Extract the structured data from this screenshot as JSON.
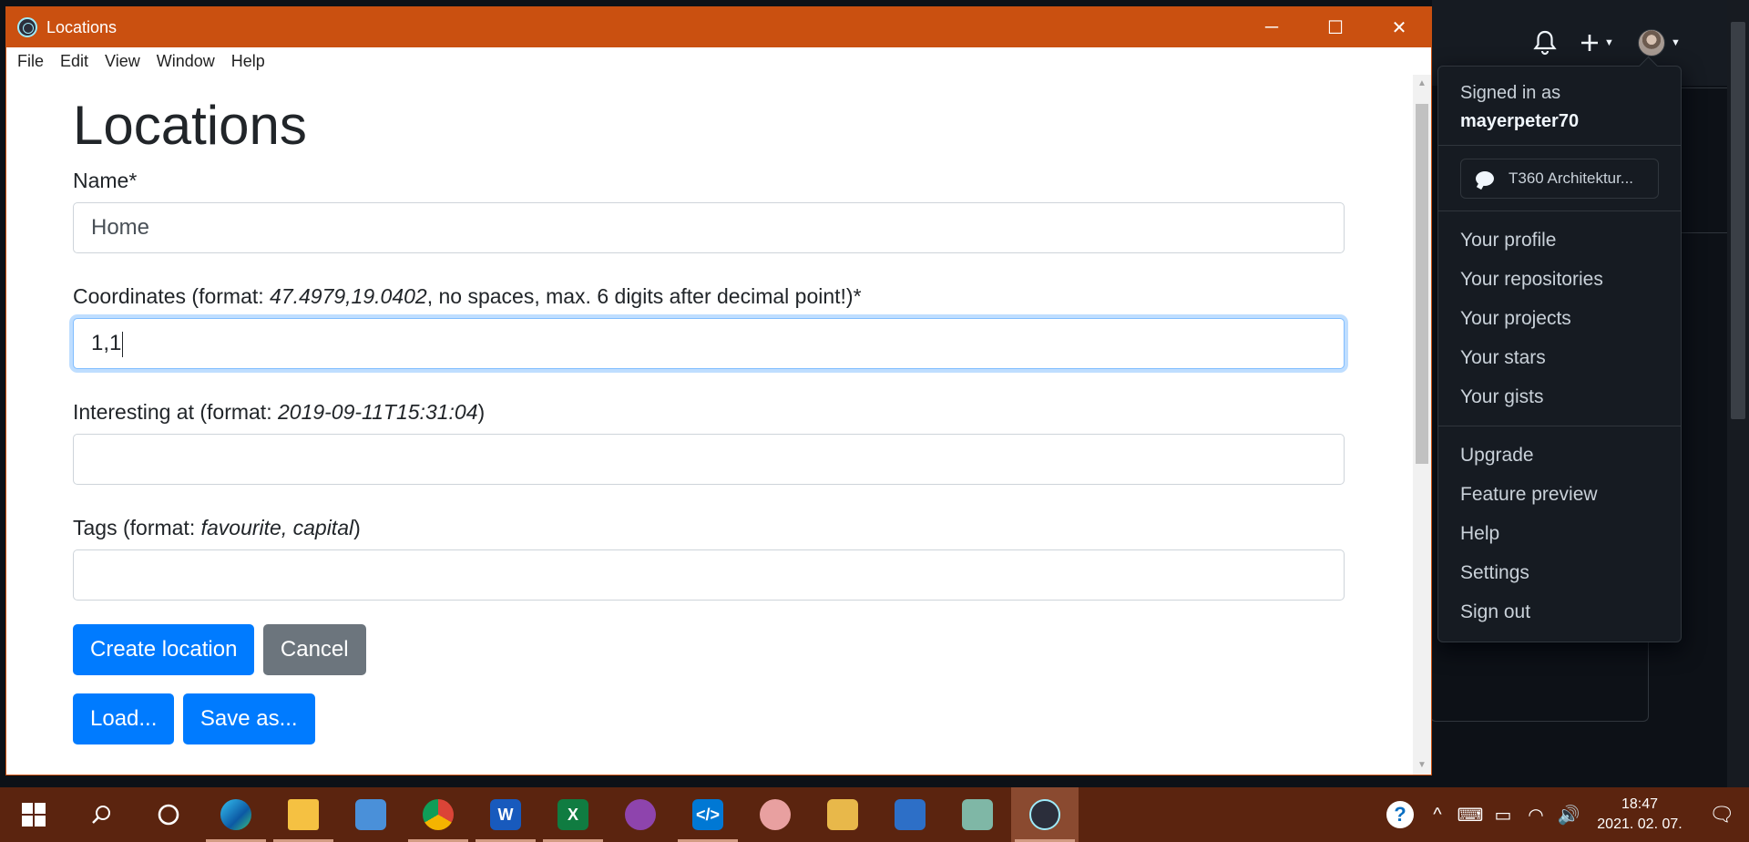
{
  "window": {
    "title": "Locations",
    "menu": [
      "File",
      "Edit",
      "View",
      "Window",
      "Help"
    ]
  },
  "form": {
    "heading": "Locations",
    "name_label": "Name*",
    "name_value": "Home",
    "coord_label_pre": "Coordinates (format: ",
    "coord_label_example": "47.4979,19.0402",
    "coord_label_post": ", no spaces, max. 6 digits after decimal point!)*",
    "coord_value": "1,1",
    "interesting_label_pre": "Interesting at (format: ",
    "interesting_label_example": "2019-09-11T15:31:04",
    "interesting_label_post": ")",
    "interesting_value": "",
    "tags_label_pre": "Tags (format: ",
    "tags_label_example": "favourite, capital",
    "tags_label_post": ")",
    "tags_value": "",
    "create_button": "Create location",
    "cancel_button": "Cancel",
    "load_button": "Load...",
    "saveas_button": "Save as..."
  },
  "github": {
    "signed_in_as": "Signed in as",
    "username": "mayerpeter70",
    "status": "T360 Architektur...",
    "menu_group1": [
      "Your profile",
      "Your repositories",
      "Your projects",
      "Your stars",
      "Your gists"
    ],
    "menu_group2": [
      "Upgrade",
      "Feature preview",
      "Help",
      "Settings",
      "Sign out"
    ]
  },
  "taskbar": {
    "apps": [
      "start-icon",
      "search-icon",
      "cortana-icon",
      "edge-icon",
      "file-explorer-icon",
      "remote-desktop-icon",
      "chrome-icon",
      "word-icon",
      "excel-icon",
      "github-desktop-icon",
      "vscode-icon",
      "snipping-tool-icon",
      "sync-folder-icon",
      "network-icon",
      "notepad-icon",
      "electron-icon"
    ],
    "time": "18:47",
    "date": "2021. 02. 07."
  },
  "colors": {
    "titlebar": "#ca5010",
    "primary": "#007bff",
    "secondary": "#6c757d",
    "taskbar": "#5b240f"
  }
}
